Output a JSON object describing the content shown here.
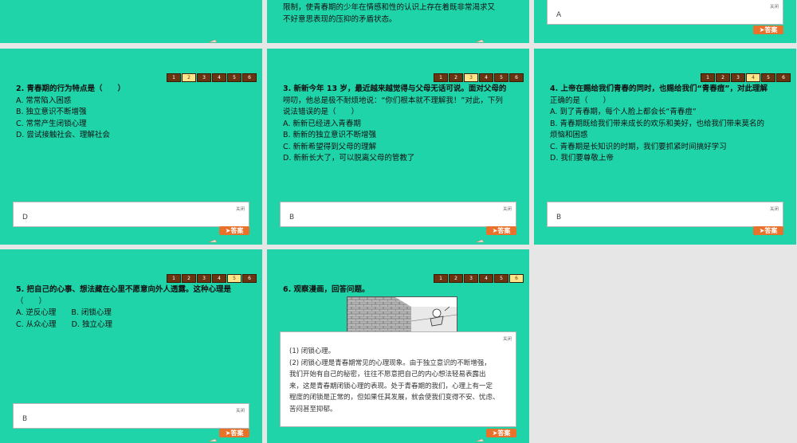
{
  "close_label": "关闭",
  "answer_button": "答案",
  "nav": [
    "1",
    "2",
    "3",
    "4",
    "5",
    "6"
  ],
  "top_middle": {
    "lines": [
      "限制，使青春期的少年在情感和性的认识上存在着既非常渴求又",
      "不好意思表现的压抑的矛盾状态。"
    ]
  },
  "top_right": {
    "answer": "A"
  },
  "q2": {
    "title": "2. 青春期的行为特点是（　　）",
    "options": [
      "A. 常常陷入困惑",
      "B. 独立意识不断增强",
      "C. 常常产生闭锁心理",
      "D. 尝试接触社会、理解社会"
    ],
    "answer": "D"
  },
  "q3": {
    "lines": [
      "3. 新新今年 13 岁，最近越来越觉得与父母无话可说。面对父母的",
      "唠叨，他总是极不耐烦地说：“你们根本就不理解我！”对此，下列",
      "说法错误的是（　　）"
    ],
    "options": [
      "A. 新新已经进入青春期",
      "B. 新新的独立意识不断增强",
      "C. 新新希望得到父母的理解",
      "D. 新新长大了，可以脱离父母的管教了"
    ],
    "answer": "B"
  },
  "q4": {
    "lines": [
      "4. 上帝在赐给我们青春的同时，也赐给我们“青春痘”，对此理解",
      "正确的是（　　）"
    ],
    "options": [
      "A. 到了青春期，每个人脸上都会长“青春痘”",
      "B. 青春期既给我们带来成长的欢乐和美好，也给我们带来莫名的",
      "烦恼和困惑",
      "C. 青春期是长知识的时期，我们要抓紧时间搞好学习",
      "D. 我们要尊敬上帝"
    ],
    "answer": "B"
  },
  "q5": {
    "lines": [
      "5. 把自己的心事、想法藏在心里不愿意向外人透露。这种心理是",
      "（　　）"
    ],
    "options": [
      "A. 逆反心理　　B. 闭锁心理",
      "C. 从众心理　　D. 独立心理"
    ],
    "answer": "B"
  },
  "q6": {
    "title": "6. 观察漫画，回答问题。",
    "answer_lines": [
      "(1) 闭锁心理。",
      "(2) 闭锁心理是青春期常见的心理现象。由于独立意识的不断增强，",
      "我们开始有自己的秘密，往往不愿意把自己的内心想法轻易表露出",
      "来，这是青春期闭锁心理的表现。处于青春期的我们，心理上有一定",
      "程度的闭锁是正常的，但如果任其发展，就会使我们变得不安、忧虑、",
      "苦闷甚至抑郁。"
    ]
  }
}
